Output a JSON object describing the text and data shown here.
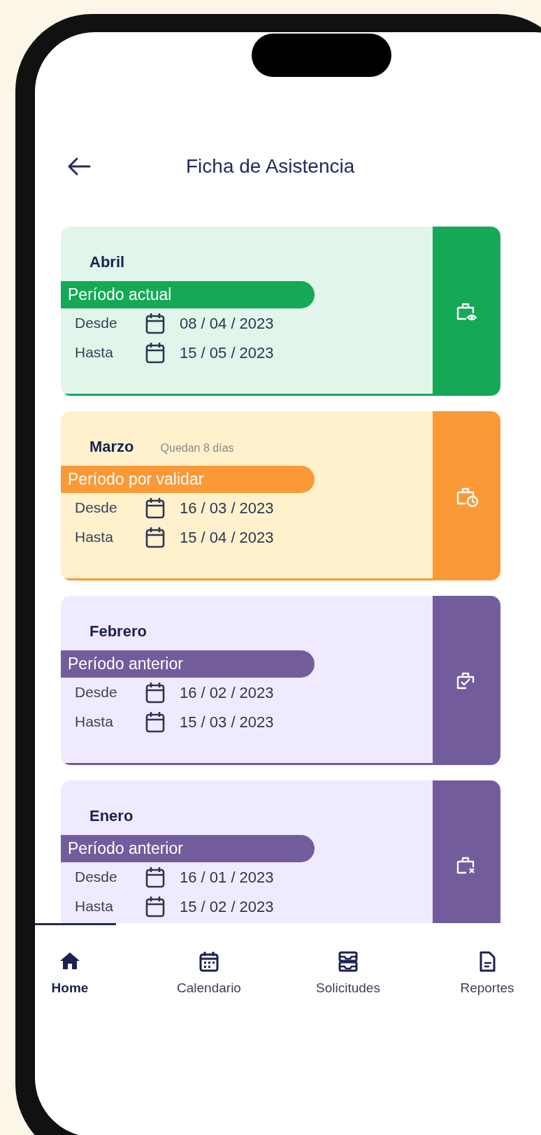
{
  "header": {
    "title": "Ficha de Asistencia"
  },
  "periods": [
    {
      "kind": "current",
      "month": "Abril",
      "status": "Período actual",
      "rows": [
        {
          "label": "Desde",
          "date": "08 / 04 / 2023"
        },
        {
          "label": "Hasta",
          "date": "15 / 05 / 2023"
        }
      ]
    },
    {
      "kind": "pending",
      "month": "Marzo",
      "note": "Quedan 8 días",
      "status": "Período por validar",
      "rows": [
        {
          "label": "Desde",
          "date": "16 / 03 / 2023"
        },
        {
          "label": "Hasta",
          "date": "15 / 04 / 2023"
        }
      ]
    },
    {
      "kind": "validated",
      "month": "Febrero",
      "status": "Período anterior",
      "rows": [
        {
          "label": "Desde",
          "date": "16 / 02 / 2023"
        },
        {
          "label": "Hasta",
          "date": "15 / 03 / 2023"
        }
      ]
    },
    {
      "kind": "rejected",
      "month": "Enero",
      "status": "Período anterior",
      "rows": [
        {
          "label": "Desde",
          "date": "16 / 01 / 2023"
        },
        {
          "label": "Hasta",
          "date": "15 / 02 / 2023"
        }
      ]
    }
  ],
  "bottom_nav": [
    {
      "kind": "home",
      "label": "Home",
      "selected": true
    },
    {
      "kind": "calendar",
      "label": "Calendario",
      "selected": false
    },
    {
      "kind": "inbox",
      "label": "Solicitudes",
      "selected": false
    },
    {
      "kind": "report",
      "label": "Reportes",
      "selected": false
    }
  ]
}
